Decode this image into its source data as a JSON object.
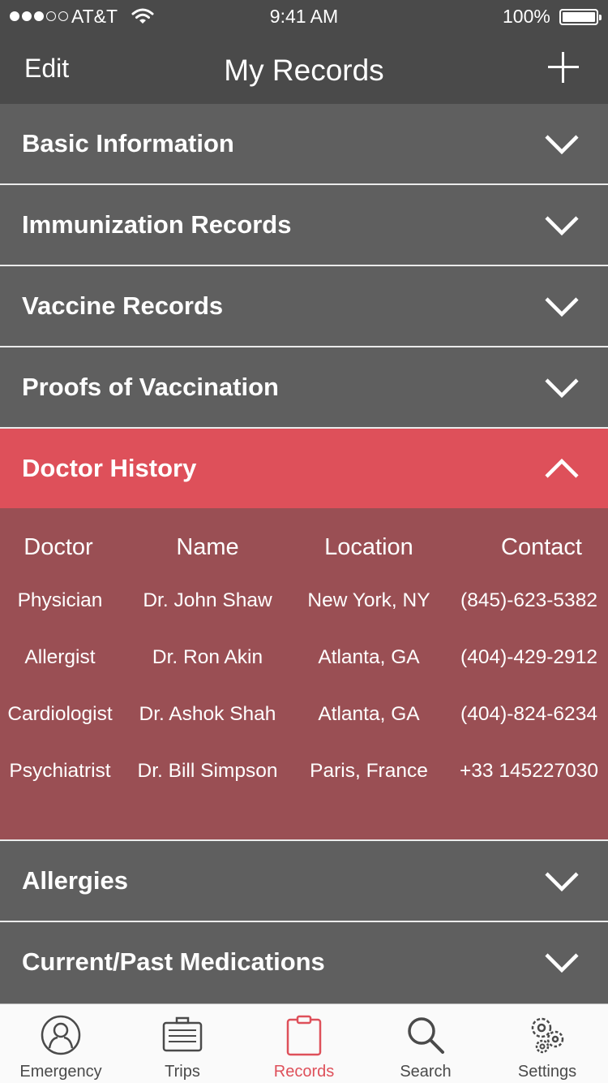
{
  "status": {
    "carrier": "AT&T",
    "time": "9:41 AM",
    "battery": "100%"
  },
  "nav": {
    "edit_label": "Edit",
    "title": "My Records",
    "add_icon": "plus-icon"
  },
  "sections": [
    {
      "label": "Basic Information",
      "expanded": false
    },
    {
      "label": "Immunization Records",
      "expanded": false
    },
    {
      "label": "Vaccine Records",
      "expanded": false
    },
    {
      "label": "Proofs of Vaccination",
      "expanded": false
    },
    {
      "label": "Doctor History",
      "expanded": true
    },
    {
      "label": "Allergies",
      "expanded": false
    },
    {
      "label": "Current/Past Medications",
      "expanded": false
    }
  ],
  "doctor_history": {
    "headers": [
      "Doctor",
      "Name",
      "Location",
      "Contact"
    ],
    "rows": [
      [
        "Physician",
        "Dr. John Shaw",
        "New York, NY",
        "(845)-623-5382"
      ],
      [
        "Allergist",
        "Dr. Ron Akin",
        "Atlanta, GA",
        "(404)-429-2912"
      ],
      [
        "Cardiologist",
        "Dr. Ashok Shah",
        "Atlanta, GA",
        "(404)-824-6234"
      ],
      [
        "Psychiatrist",
        "Dr. Bill Simpson",
        "Paris, France",
        "+33 145227030"
      ]
    ]
  },
  "tabs": [
    {
      "label": "Emergency",
      "icon": "person-icon",
      "active": false
    },
    {
      "label": "Trips",
      "icon": "suitcase-icon",
      "active": false
    },
    {
      "label": "Records",
      "icon": "clipboard-icon",
      "active": true
    },
    {
      "label": "Search",
      "icon": "search-icon",
      "active": false
    },
    {
      "label": "Settings",
      "icon": "gears-icon",
      "active": false
    }
  ],
  "colors": {
    "nav_bg": "#4a4a4a",
    "section_bg": "#5f5f5f",
    "accent": "#de505a",
    "expanded_panel": "#9a4f54",
    "tab_bar_bg": "#fafafa"
  }
}
